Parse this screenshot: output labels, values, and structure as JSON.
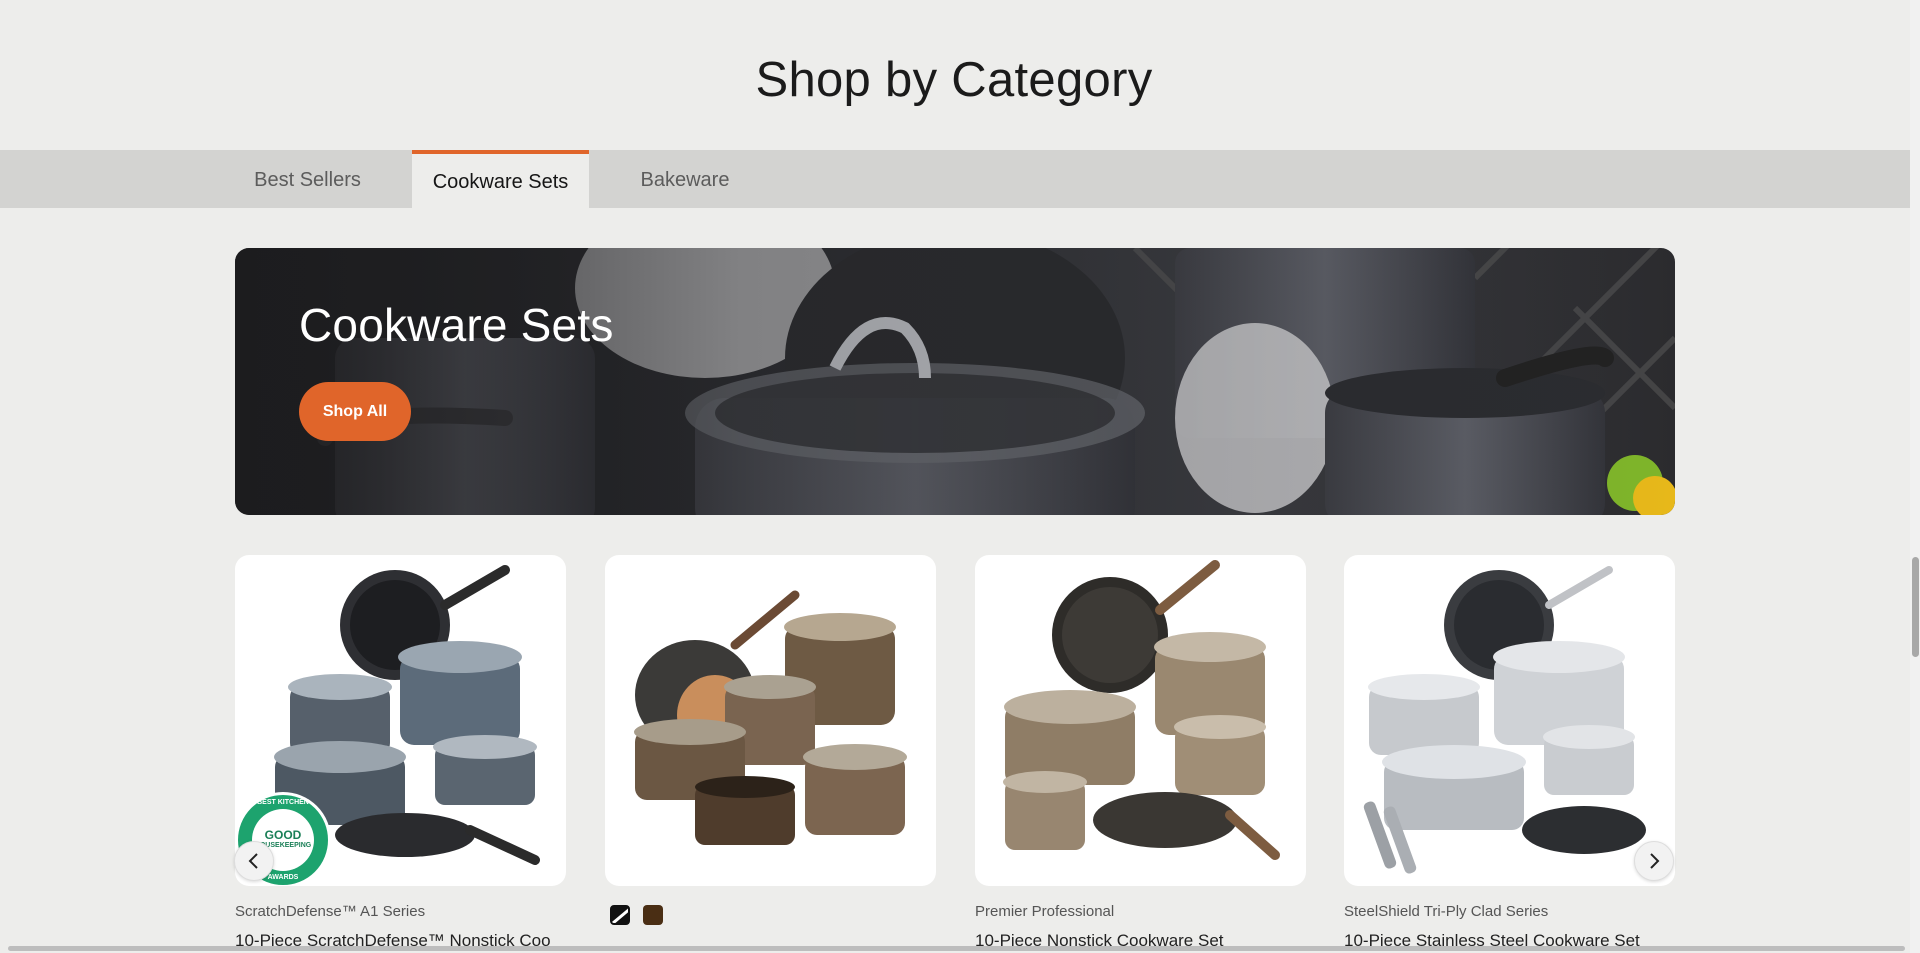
{
  "section": {
    "title": "Shop by Category"
  },
  "tabs": [
    {
      "label": "Best Sellers",
      "active": false
    },
    {
      "label": "Cookware Sets",
      "active": true
    },
    {
      "label": "Bakeware",
      "active": false
    }
  ],
  "hero": {
    "title": "Cookware Sets",
    "button_label": "Shop All"
  },
  "badge": {
    "line1": "BEST KITCHEN",
    "line2": "GOOD",
    "line3": "HOUSEKEEPING",
    "line4": "AWARDS"
  },
  "products": [
    {
      "series": "ScratchDefense™ A1 Series",
      "name": "10-Piece ScratchDefense™ Nonstick Coo"
    },
    {
      "series": "",
      "name": "",
      "swatches": [
        "black",
        "bronze"
      ]
    },
    {
      "series": "Premier Professional",
      "name": "10-Piece Nonstick Cookware Set"
    },
    {
      "series": "SteelShield Tri-Ply Clad Series",
      "name": "10-Piece Stainless Steel Cookware Set"
    }
  ],
  "colors": {
    "accent": "#e0652a",
    "background": "#ededeb",
    "tabbar": "#d3d3d1"
  },
  "icons": {
    "prev": "chevron-left-icon",
    "next": "chevron-right-icon"
  }
}
